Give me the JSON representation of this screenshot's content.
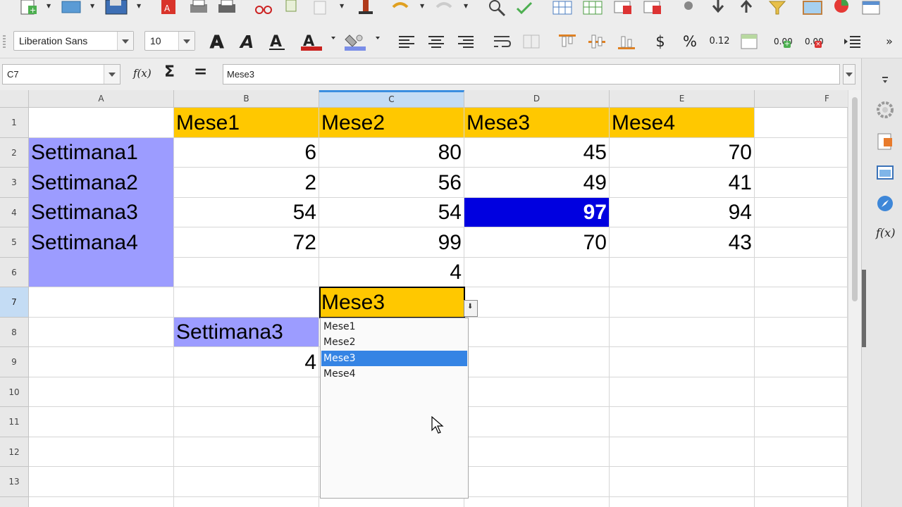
{
  "font_toolbar": {
    "font_name": "Liberation Sans",
    "font_size": "10",
    "currency_label": "$",
    "percent_label": "%",
    "decimal_label": "0.12",
    "add_decimal_label": "0.00",
    "remove_decimal_label": "0.00"
  },
  "formula_bar": {
    "name_box": "C7",
    "fx_label": "f(x)",
    "sum_label": "Σ",
    "equals_label": "=",
    "content": "Mese3"
  },
  "columns": [
    "A",
    "B",
    "C",
    "D",
    "E",
    "F"
  ],
  "rows": [
    "1",
    "2",
    "3",
    "4",
    "5",
    "6",
    "7",
    "8",
    "9",
    "10",
    "11",
    "12",
    "13"
  ],
  "cells": {
    "B1": "Mese1",
    "C1": "Mese2",
    "D1": "Mese3",
    "E1": "Mese4",
    "A2": "Settimana1",
    "B2": "6",
    "C2": "80",
    "D2": "45",
    "E2": "70",
    "A3": "Settimana2",
    "B3": "2",
    "C3": "56",
    "D3": "49",
    "E3": "41",
    "A4": "Settimana3",
    "B4": "54",
    "C4": "54",
    "D4": "97",
    "E4": "94",
    "A5": "Settimana4",
    "B5": "72",
    "C5": "99",
    "D5": "70",
    "E5": "43",
    "C6": "4",
    "C7": "Mese3",
    "B8": "Settimana3",
    "B9": "4"
  },
  "validation_list": {
    "options": [
      "Mese1",
      "Mese2",
      "Mese3",
      "Mese4"
    ],
    "selected": "Mese3"
  },
  "colors": {
    "header_gold": "#ffc800",
    "row_label_lavender": "#9c9cff",
    "highlight_blue": "#0000e0",
    "selection_blue": "#3584e4"
  }
}
